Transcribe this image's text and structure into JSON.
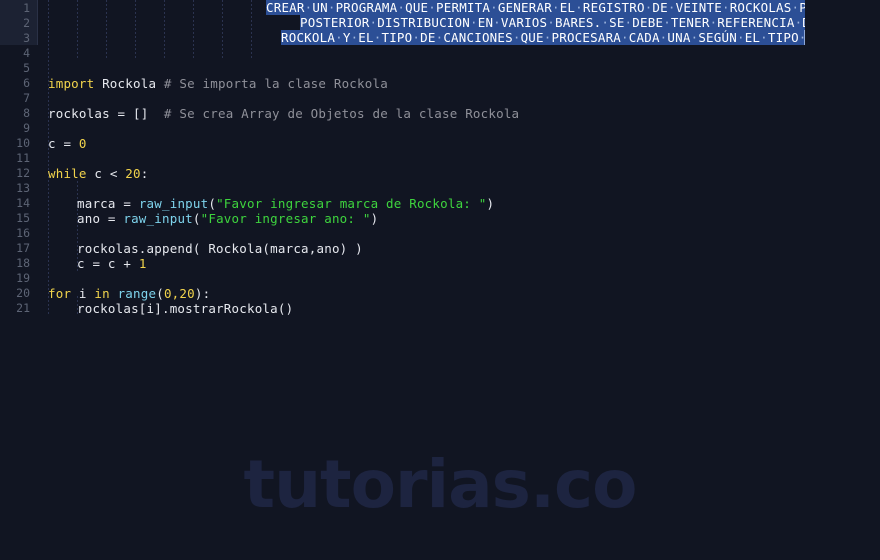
{
  "editor": {
    "language": "Python",
    "total_lines": 21,
    "colors": {
      "background": "#111522",
      "gutter_background": "#111522",
      "gutter_highlight": "#1c2233",
      "line_number": "#5d6475",
      "selection_background": "#2c4f96",
      "selection_text": "#ffffff",
      "keyword": "#f2d44c",
      "function": "#7ed3ec",
      "string": "#3ed43e",
      "comment": "#8f9099",
      "plain_text": "#e6e8ee",
      "indent_guide": "#2b3350",
      "watermark": "#1d2440"
    },
    "line_numbers": [
      1,
      2,
      3,
      4,
      5,
      6,
      7,
      8,
      9,
      10,
      11,
      12,
      13,
      14,
      15,
      16,
      17,
      18,
      19,
      20,
      21
    ],
    "selected_lines": [
      1,
      2,
      3
    ],
    "selection_text_lines": [
      "CREAR UN PROGRAMA QUE PERMITA GENERAR EL REGISTRO DE VEINTE ROCKOLAS PARA SU",
      "POSTERIOR DISTRIBUCION EN VARIOS BARES. SE DEBE TENER REFERENCIA DE CADA",
      "ROCKOLA Y EL TIPO DE CANCIONES QUE PROCESARA CADA UNA SEGÚN EL TIPO DE BAR"
    ],
    "code_lines": [
      {
        "line": 6,
        "indent": 0,
        "text": "import Rockola # Se importa la clase Rockola"
      },
      {
        "line": 8,
        "indent": 0,
        "text": "rockolas = []  # Se crea Array de Objetos de la clase Rockola"
      },
      {
        "line": 10,
        "indent": 0,
        "text": "c = 0"
      },
      {
        "line": 12,
        "indent": 0,
        "text": "while c < 20:"
      },
      {
        "line": 14,
        "indent": 1,
        "text": "marca = raw_input(\"Favor ingresar marca de Rockola: \")"
      },
      {
        "line": 15,
        "indent": 1,
        "text": "ano = raw_input(\"Favor ingresar ano: \")"
      },
      {
        "line": 17,
        "indent": 1,
        "text": "rockolas.append( Rockola(marca,ano) )"
      },
      {
        "line": 18,
        "indent": 1,
        "text": "c = c + 1"
      },
      {
        "line": 20,
        "indent": 0,
        "text": "for i in range(0,20):"
      },
      {
        "line": 21,
        "indent": 1,
        "text": "rockolas[i].mostrarRockola()"
      }
    ],
    "tokens": {
      "l6": {
        "kw": "import",
        "plain": " Rockola ",
        "comment": "# Se importa la clase Rockola"
      },
      "l8": {
        "plain": "rockolas = []  ",
        "comment": "# Se crea Array de Objetos de la clase Rockola"
      },
      "l10": {
        "plain": "c = ",
        "num": "0"
      },
      "l12": {
        "kw": "while",
        "plain": " c < ",
        "num": "20",
        "tail": ":"
      },
      "l14": {
        "plain": "marca = ",
        "fn": "raw_input",
        "p1": "(",
        "str": "\"Favor ingresar marca de Rockola: \"",
        "p2": ")"
      },
      "l15": {
        "plain": "ano = ",
        "fn": "raw_input",
        "p1": "(",
        "str": "\"Favor ingresar ano: \"",
        "p2": ")"
      },
      "l17": {
        "plain": "rockolas.append( Rockola(marca,ano) )"
      },
      "l18": {
        "plain": "c = c + ",
        "num": "1"
      },
      "l20": {
        "kw1": "for",
        "mid": " i ",
        "kw2": "in",
        "sp": " ",
        "fn": "range",
        "p1": "(",
        "num": "0,20",
        "p2": "):"
      },
      "l21": {
        "plain": "rockolas[i].mostrarRockola()"
      }
    }
  },
  "watermark": {
    "text": "tutorias.co"
  }
}
